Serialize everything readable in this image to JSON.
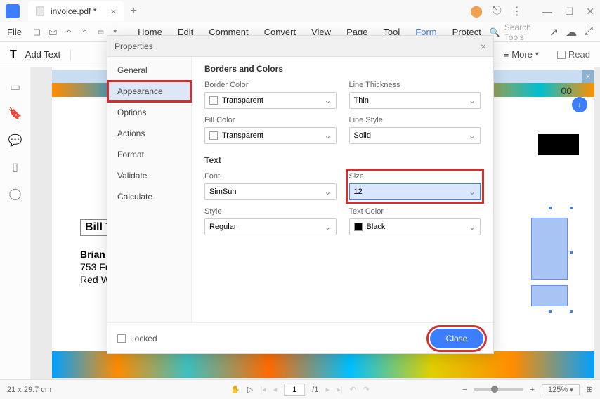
{
  "titlebar": {
    "tab_name": "invoice.pdf *"
  },
  "menu": {
    "file": "File",
    "home": "Home",
    "edit": "Edit",
    "comment": "Comment",
    "convert": "Convert",
    "view": "View",
    "page": "Page",
    "tool": "Tool",
    "form": "Form",
    "protect": "Protect",
    "search_placeholder": "Search Tools"
  },
  "toolbar2": {
    "add_text": "Add Text",
    "more": "More",
    "read": "Read"
  },
  "document": {
    "top_number": "00",
    "bill_to": "Bill T",
    "name": "Brian",
    "addr1": "753 Fr",
    "addr2": "Red W"
  },
  "dialog": {
    "title": "Properties",
    "sidebar": [
      "General",
      "Appearance",
      "Options",
      "Actions",
      "Format",
      "Validate",
      "Calculate"
    ],
    "section_borders": "Borders and Colors",
    "section_text": "Text",
    "labels": {
      "border_color": "Border Color",
      "line_thickness": "Line Thickness",
      "fill_color": "Fill Color",
      "line_style": "Line Style",
      "font": "Font",
      "size": "Size",
      "style": "Style",
      "text_color": "Text Color"
    },
    "values": {
      "border_color": "Transparent",
      "line_thickness": "Thin",
      "fill_color": "Transparent",
      "line_style": "Solid",
      "font": "SimSun",
      "size": "12",
      "style": "Regular",
      "text_color": "Black"
    },
    "locked": "Locked",
    "close": "Close"
  },
  "statusbar": {
    "dimensions": "21 x 29.7 cm",
    "page_current": "1",
    "page_total": "/1",
    "zoom": "125%"
  }
}
